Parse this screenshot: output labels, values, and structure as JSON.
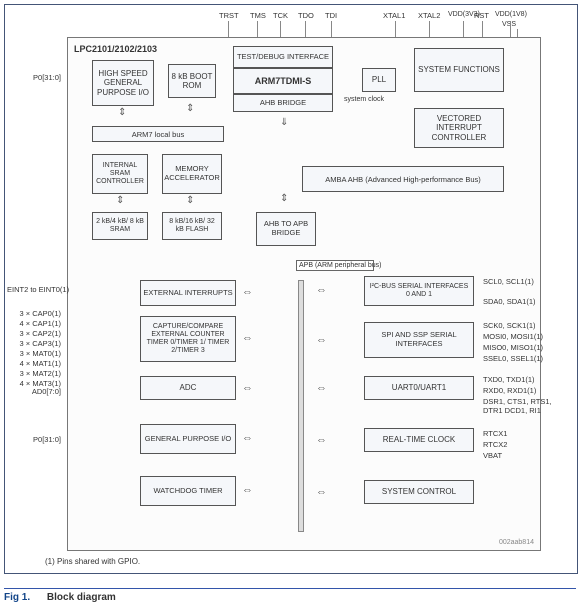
{
  "chip_title": "LPC2101/2102/2103",
  "top_pins": {
    "trst": "TRST",
    "tms": "TMS",
    "tck": "TCK",
    "tdo": "TDO",
    "tdi": "TDI",
    "xtal1": "XTAL1",
    "xtal2": "XTAL2",
    "rst": "RST",
    "vdd33": "VDD(3V3)",
    "vdd18": "VDD(1V8)",
    "vss": "VSS"
  },
  "left_pins": {
    "p0_top": "P0[31:0]",
    "eint": "EINT2 to EINT0(1)",
    "cap0": "3 × CAP0(1)",
    "cap1": "4 × CAP1(1)",
    "cap2": "3 × CAP2(1)",
    "cap3": "3 × CAP3(1)",
    "mat0": "3 × MAT0(1)",
    "mat1": "4 × MAT1(1)",
    "mat2": "3 × MAT2(1)",
    "mat3": "4 × MAT3(1)",
    "ad0": "AD0[7:0]",
    "p0_bot": "P0[31:0]"
  },
  "right_pins": {
    "scl": "SCL0, SCL1(1)",
    "sda": "SDA0, SDA1(1)",
    "sck": "SCK0, SCK1(1)",
    "mosi": "MOSI0, MOSI1(1)",
    "miso": "MISO0, MISO1(1)",
    "ssel": "SSEL0, SSEL1(1)",
    "txd": "TXD0, TXD1(1)",
    "rxd": "RXD0, RXD1(1)",
    "mctrl": "DSR1, CTS1, RTS1, DTR1 DCD1, RI1",
    "rtcx1": "RTCX1",
    "rtcx2": "RTCX2",
    "vbat": "VBAT"
  },
  "blocks": {
    "hsgpio": "HIGH SPEED GENERAL PURPOSE I/O",
    "bootrom": "8 kB BOOT ROM",
    "testdbg": "TEST/DEBUG INTERFACE",
    "core": "ARM7TDMI-S",
    "ahbbridge": "AHB BRIDGE",
    "pll": "PLL",
    "sysfunc": "SYSTEM FUNCTIONS",
    "sysclock_lbl": "system clock",
    "vic": "VECTORED INTERRUPT CONTROLLER",
    "arm7bus": "ARM7 local bus",
    "isram": "INTERNAL SRAM CONTROLLER",
    "mam": "MEMORY ACCELERATOR",
    "sram": "2 kB/4 kB/ 8 kB SRAM",
    "flash": "8 kB/16 kB/ 32 kB FLASH",
    "ambaahb": "AMBA AHB (Advanced High-performance Bus)",
    "ahb2apb": "AHB TO APB BRIDGE",
    "apbbus_lbl": "APB (ARM peripheral bus)",
    "extint": "EXTERNAL INTERRUPTS",
    "captim": "CAPTURE/COMPARE EXTERNAL COUNTER TIMER 0/TIMER 1/ TIMER 2/TIMER 3",
    "adc": "ADC",
    "gpio": "GENERAL PURPOSE I/O",
    "wdt": "WATCHDOG TIMER",
    "i2c": "I²C-BUS SERIAL INTERFACES 0 AND 1",
    "spi": "SPI AND SSP SERIAL INTERFACES",
    "uart": "UART0/UART1",
    "rtc": "REAL-TIME CLOCK",
    "sysctrl": "SYSTEM CONTROL"
  },
  "footnote": "(1)   Pins shared with GPIO.",
  "fig_no": "Fig 1.",
  "fig_title": "Block diagram",
  "docid": "002aab814"
}
